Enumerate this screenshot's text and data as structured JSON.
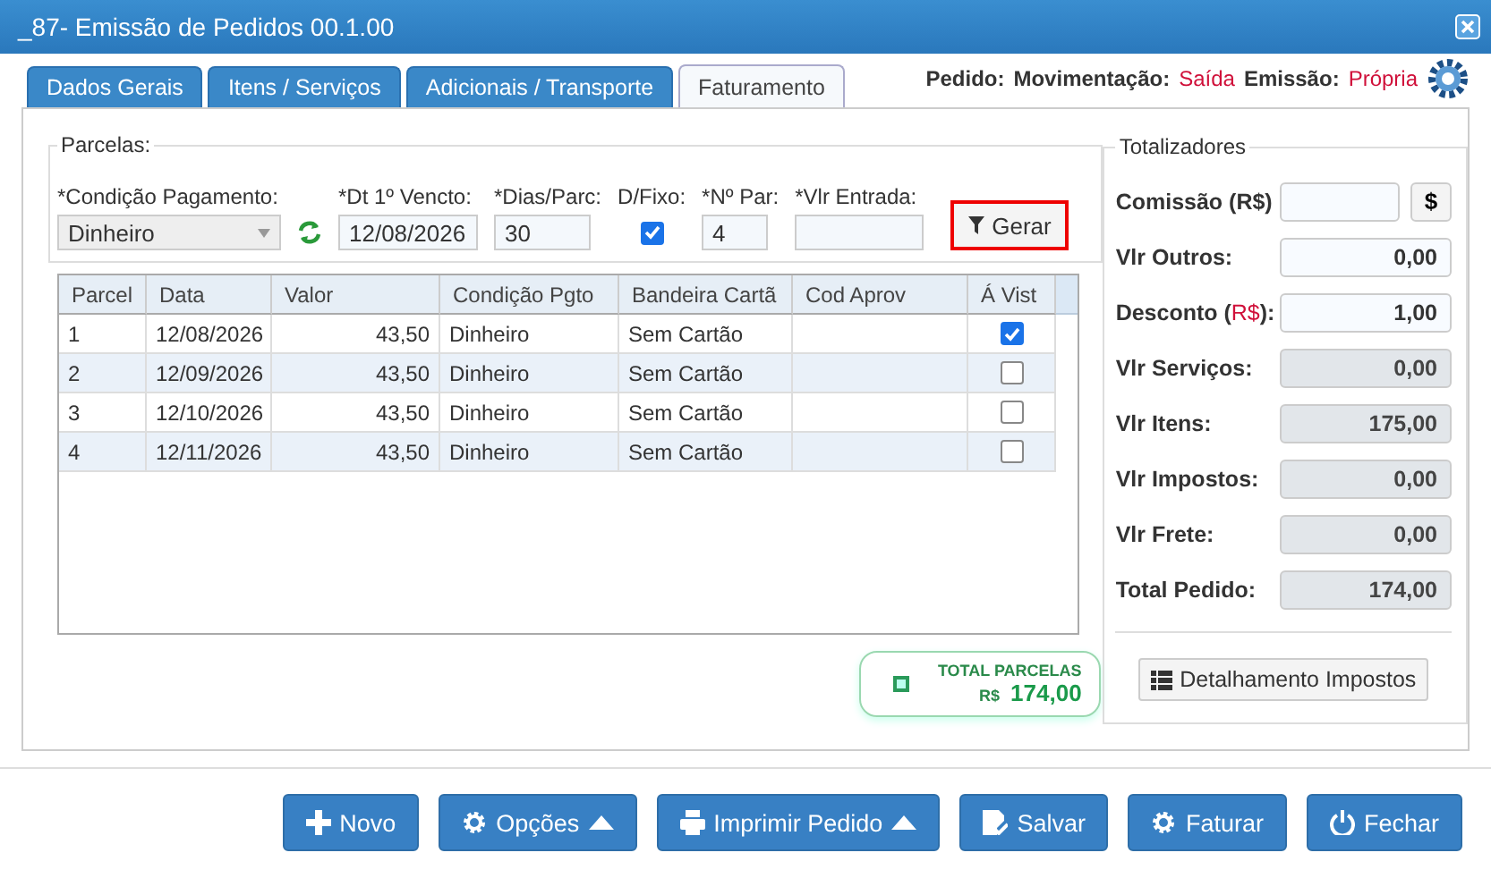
{
  "window": {
    "title": "_87- Emissão de Pedidos 00.1.00"
  },
  "tabs": [
    {
      "label": "Dados Gerais",
      "selected": false
    },
    {
      "label": "Itens / Serviços",
      "selected": false
    },
    {
      "label": "Adicionais / Transporte",
      "selected": false
    },
    {
      "label": "Faturamento",
      "selected": true
    }
  ],
  "order_info": [
    {
      "label": "Pedido:"
    },
    {
      "label": "Movimentação:",
      "value": "Saída"
    },
    {
      "label": "Emissão:",
      "value": "Própria"
    }
  ],
  "parcelas": {
    "legend": "Parcelas:",
    "condition": {
      "label": "*Condição Pagamento:",
      "value": "Dinheiro"
    },
    "first_due": {
      "label": "*Dt 1º Vencto:",
      "value": "12/08/2026"
    },
    "days": {
      "label": "*Dias/Parc:",
      "value": "30"
    },
    "fixed_day": {
      "label": "D/Fixo:",
      "checked": true
    },
    "count": {
      "label": "*Nº Par:",
      "value": "4"
    },
    "down_payment": {
      "label": "*Vlr Entrada:"
    },
    "generate_button": {
      "label": "Gerar",
      "highlighted": true
    }
  },
  "table": {
    "columns": [
      "Parcel",
      "Data",
      "Valor",
      "Condição Pgto",
      "Bandeira Cartã",
      "Cod Aprov",
      "Á Vist"
    ],
    "rows": [
      {
        "cells": [
          "1",
          "12/08/2026",
          "43,50",
          "Dinheiro",
          "Sem Cartão"
        ],
        "a_vista": true
      },
      {
        "cells": [
          "2",
          "12/09/2026",
          "43,50",
          "Dinheiro",
          "Sem Cartão"
        ],
        "a_vista": false
      },
      {
        "cells": [
          "3",
          "12/10/2026",
          "43,50",
          "Dinheiro",
          "Sem Cartão"
        ],
        "a_vista": false
      },
      {
        "cells": [
          "4",
          "12/11/2026",
          "43,50",
          "Dinheiro",
          "Sem Cartão"
        ],
        "a_vista": false
      }
    ]
  },
  "total_parcelas": {
    "label": "TOTAL PARCELAS",
    "currency": "R$",
    "value": "174,00"
  },
  "totalizadores": {
    "legend": "Totalizadores",
    "rows": [
      {
        "label": "Comissão (R$)",
        "kind": "editable",
        "button": "$"
      },
      {
        "label": "Vlr Outros:",
        "value": "0,00",
        "kind": "editable"
      },
      {
        "label": "Desconto (",
        "unit": "R$",
        "label_end": "):",
        "value": "1,00",
        "kind": "editable"
      },
      {
        "label": "Vlr Serviços:",
        "value": "0,00",
        "kind": "readonly"
      },
      {
        "label": "Vlr Itens:",
        "value": "175,00",
        "kind": "readonly"
      },
      {
        "label": "Vlr Impostos:",
        "value": "0,00",
        "kind": "readonly"
      },
      {
        "label": "Vlr Frete:",
        "value": "0,00",
        "kind": "readonly"
      },
      {
        "label": "Total Pedido:",
        "value": "174,00",
        "kind": "readonly"
      }
    ],
    "details_button": "Detalhamento Impostos"
  },
  "buttons": [
    {
      "label": "Novo",
      "kind": "new",
      "caret": false
    },
    {
      "label": "Opções",
      "kind": "options",
      "caret": true
    },
    {
      "label": "Imprimir Pedido",
      "kind": "print",
      "caret": true
    },
    {
      "label": "Salvar",
      "kind": "save",
      "caret": false
    },
    {
      "label": "Faturar",
      "kind": "invoice",
      "caret": false
    },
    {
      "label": "Fechar",
      "kind": "exit",
      "caret": false
    }
  ]
}
